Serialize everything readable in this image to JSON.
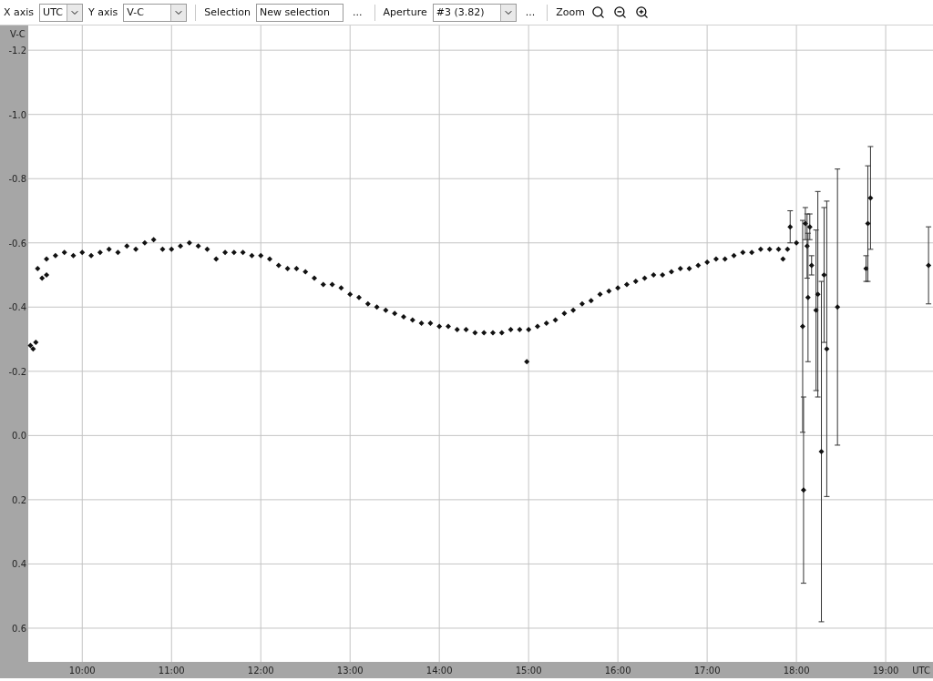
{
  "toolbar": {
    "x_axis": {
      "label": "X axis",
      "value": "UTC"
    },
    "y_axis": {
      "label": "Y axis",
      "value": "V-C"
    },
    "selection": {
      "label": "Selection",
      "value": "New selection",
      "more": "..."
    },
    "aperture": {
      "label": "Aperture",
      "value": "#3 (3.82)",
      "more": "..."
    },
    "zoom": {
      "label": "Zoom"
    }
  },
  "chart": {
    "chart_data": {
      "type": "scatter",
      "grid": true,
      "xlabel": "UTC",
      "ylabel": "V-C",
      "xlim": [
        9.395,
        19.53
      ],
      "ylim": [
        0.705,
        -1.277
      ],
      "xticks": [
        {
          "value": 10,
          "label": "10:00"
        },
        {
          "value": 11,
          "label": "11:00"
        },
        {
          "value": 12,
          "label": "12:00"
        },
        {
          "value": 13,
          "label": "13:00"
        },
        {
          "value": 14,
          "label": "14:00"
        },
        {
          "value": 15,
          "label": "15:00"
        },
        {
          "value": 16,
          "label": "16:00"
        },
        {
          "value": 17,
          "label": "17:00"
        },
        {
          "value": 18,
          "label": "18:00"
        },
        {
          "value": 19,
          "label": "19:00"
        }
      ],
      "yticks": [
        {
          "value": -1.2,
          "label": "-1.2"
        },
        {
          "value": -1.0,
          "label": "-1.0"
        },
        {
          "value": -0.8,
          "label": "-0.8"
        },
        {
          "value": -0.6,
          "label": "-0.6"
        },
        {
          "value": -0.4,
          "label": "-0.4"
        },
        {
          "value": -0.2,
          "label": "-0.2"
        },
        {
          "value": 0,
          "label": "0.0"
        },
        {
          "value": 0.2,
          "label": "0.2"
        },
        {
          "value": 0.4,
          "label": "0.4"
        },
        {
          "value": 0.6,
          "label": "0.6"
        }
      ],
      "series": [
        {
          "color": "#111111",
          "x": [
            9.42,
            9.45,
            9.48,
            9.5,
            9.55,
            9.6,
            9.6,
            9.7,
            9.8,
            9.9,
            10.0,
            10.1,
            10.2,
            10.3,
            10.4,
            10.5,
            10.6,
            10.7,
            10.8,
            10.9,
            11.0,
            11.1,
            11.2,
            11.3,
            11.4,
            11.5,
            11.6,
            11.7,
            11.8,
            11.9,
            12.0,
            12.1,
            12.2,
            12.3,
            12.4,
            12.5,
            12.6,
            12.7,
            12.8,
            12.9,
            13.0,
            13.1,
            13.2,
            13.3,
            13.4,
            13.5,
            13.6,
            13.7,
            13.8,
            13.9,
            14.0,
            14.1,
            14.2,
            14.3,
            14.4,
            14.5,
            14.6,
            14.7,
            14.8,
            14.9,
            14.98,
            15.0,
            15.1,
            15.2,
            15.3,
            15.4,
            15.5,
            15.6,
            15.7,
            15.8,
            15.9,
            16.0,
            16.1,
            16.2,
            16.3,
            16.4,
            16.5,
            16.6,
            16.7,
            16.8,
            16.9,
            17.0,
            17.1,
            17.2,
            17.3,
            17.4,
            17.5,
            17.6,
            17.7,
            17.8,
            17.85,
            17.9,
            18.0
          ],
          "values": [
            -0.28,
            -0.27,
            -0.29,
            -0.52,
            -0.49,
            -0.5,
            -0.55,
            -0.56,
            -0.57,
            -0.56,
            -0.57,
            -0.56,
            -0.57,
            -0.58,
            -0.57,
            -0.59,
            -0.58,
            -0.6,
            -0.61,
            -0.58,
            -0.58,
            -0.59,
            -0.6,
            -0.59,
            -0.58,
            -0.55,
            -0.57,
            -0.57,
            -0.57,
            -0.56,
            -0.56,
            -0.55,
            -0.53,
            -0.52,
            -0.52,
            -0.51,
            -0.49,
            -0.47,
            -0.47,
            -0.46,
            -0.44,
            -0.43,
            -0.41,
            -0.4,
            -0.39,
            -0.38,
            -0.37,
            -0.36,
            -0.35,
            -0.35,
            -0.34,
            -0.34,
            -0.33,
            -0.33,
            -0.32,
            -0.32,
            -0.32,
            -0.32,
            -0.33,
            -0.33,
            -0.23,
            -0.33,
            -0.34,
            -0.35,
            -0.36,
            -0.38,
            -0.39,
            -0.41,
            -0.42,
            -0.44,
            -0.45,
            -0.46,
            -0.47,
            -0.48,
            -0.49,
            -0.5,
            -0.5,
            -0.51,
            -0.52,
            -0.52,
            -0.53,
            -0.54,
            -0.55,
            -0.55,
            -0.56,
            -0.57,
            -0.57,
            -0.58,
            -0.58,
            -0.58,
            -0.55,
            -0.58,
            -0.6
          ]
        },
        {
          "color": "#111111",
          "x": [
            17.93,
            18.07,
            18.08,
            18.1,
            18.12,
            18.13,
            18.15,
            18.17,
            18.22,
            18.24,
            18.28,
            18.31,
            18.34,
            18.46,
            18.78,
            18.8,
            18.83,
            19.48
          ],
          "values": [
            -0.65,
            -0.34,
            0.17,
            -0.66,
            -0.59,
            -0.43,
            -0.65,
            -0.53,
            -0.39,
            -0.44,
            0.05,
            -0.5,
            -0.27,
            -0.4,
            -0.52,
            -0.66,
            -0.74,
            -0.53
          ],
          "errors": [
            0.05,
            0.33,
            0.29,
            0.05,
            0.1,
            0.2,
            0.04,
            0.03,
            0.25,
            0.32,
            0.53,
            0.21,
            0.46,
            0.43,
            0.04,
            0.18,
            0.16,
            0.12
          ]
        }
      ]
    }
  }
}
